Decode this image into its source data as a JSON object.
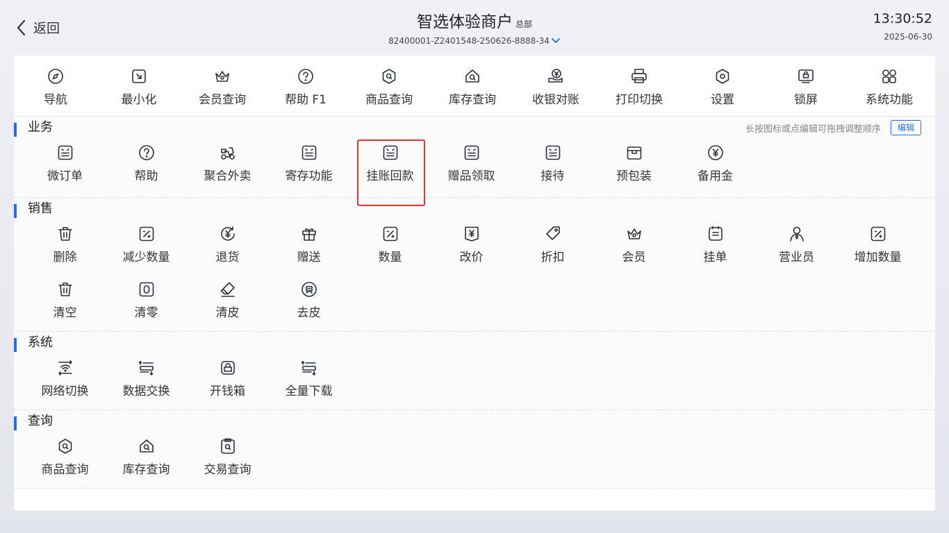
{
  "header": {
    "back_label": "返回",
    "store_name": "智选体验商户",
    "store_badge": "总部",
    "terminal_id": "82400001-Z2401548-250626-8888-34",
    "time": "13:30:52",
    "date": "2025-06-30"
  },
  "toolbar": [
    {
      "label": "导航",
      "icon": "compass-icon"
    },
    {
      "label": "最小化",
      "icon": "minimize-icon"
    },
    {
      "label": "会员查询",
      "icon": "crown-icon"
    },
    {
      "label": "帮助 F1",
      "icon": "help-icon"
    },
    {
      "label": "商品查询",
      "icon": "product-search-icon"
    },
    {
      "label": "库存查询",
      "icon": "inventory-search-icon"
    },
    {
      "label": "收银对账",
      "icon": "reconcile-icon"
    },
    {
      "label": "打印切换",
      "icon": "printer-icon"
    },
    {
      "label": "设置",
      "icon": "settings-icon"
    },
    {
      "label": "锁屏",
      "icon": "lock-screen-icon"
    },
    {
      "label": "系统功能",
      "icon": "apps-icon"
    }
  ],
  "sections": {
    "business": {
      "title": "业务",
      "hint": "长按图标或点编辑可拖拽调整顺序",
      "edit_label": "编辑",
      "items": [
        {
          "label": "微订单",
          "icon": "mini-order-icon"
        },
        {
          "label": "帮助",
          "icon": "help-icon"
        },
        {
          "label": "聚合外卖",
          "icon": "delivery-icon"
        },
        {
          "label": "寄存功能",
          "icon": "storage-icon"
        },
        {
          "label": "挂账回款",
          "icon": "credit-repayment-icon"
        },
        {
          "label": "赠品领取",
          "icon": "gift-claim-icon"
        },
        {
          "label": "接待",
          "icon": "reception-icon"
        },
        {
          "label": "预包装",
          "icon": "package-icon"
        },
        {
          "label": "备用金",
          "icon": "yen-coin-icon"
        }
      ]
    },
    "sales": {
      "title": "销售",
      "items": [
        {
          "label": "删除",
          "icon": "trash-icon"
        },
        {
          "label": "减少数量",
          "icon": "quantity-decrease-icon"
        },
        {
          "label": "退货",
          "icon": "return-icon"
        },
        {
          "label": "赠送",
          "icon": "gift-icon"
        },
        {
          "label": "数量",
          "icon": "quantity-icon"
        },
        {
          "label": "改价",
          "icon": "price-change-icon"
        },
        {
          "label": "折扣",
          "icon": "discount-tag-icon"
        },
        {
          "label": "会员",
          "icon": "crown-icon"
        },
        {
          "label": "挂单",
          "icon": "hold-order-icon"
        },
        {
          "label": "营业员",
          "icon": "clerk-icon"
        },
        {
          "label": "增加数量",
          "icon": "quantity-increase-icon"
        },
        {
          "label": "清空",
          "icon": "trash-icon"
        },
        {
          "label": "清零",
          "icon": "zero-icon"
        },
        {
          "label": "清皮",
          "icon": "eraser-icon"
        },
        {
          "label": "去皮",
          "icon": "tare-icon"
        }
      ]
    },
    "system": {
      "title": "系统",
      "items": [
        {
          "label": "网络切换",
          "icon": "network-switch-icon"
        },
        {
          "label": "数据交换",
          "icon": "data-exchange-icon"
        },
        {
          "label": "开钱箱",
          "icon": "cash-drawer-icon"
        },
        {
          "label": "全量下载",
          "icon": "full-download-icon"
        }
      ]
    },
    "query": {
      "title": "查询",
      "items": [
        {
          "label": "商品查询",
          "icon": "product-search-icon"
        },
        {
          "label": "库存查询",
          "icon": "inventory-search-icon"
        },
        {
          "label": "交易查询",
          "icon": "transaction-search-icon"
        }
      ]
    }
  },
  "colors": {
    "accent": "#1f6feb",
    "highlight": "#e8322c",
    "icon_stroke": "#2b2f38"
  }
}
